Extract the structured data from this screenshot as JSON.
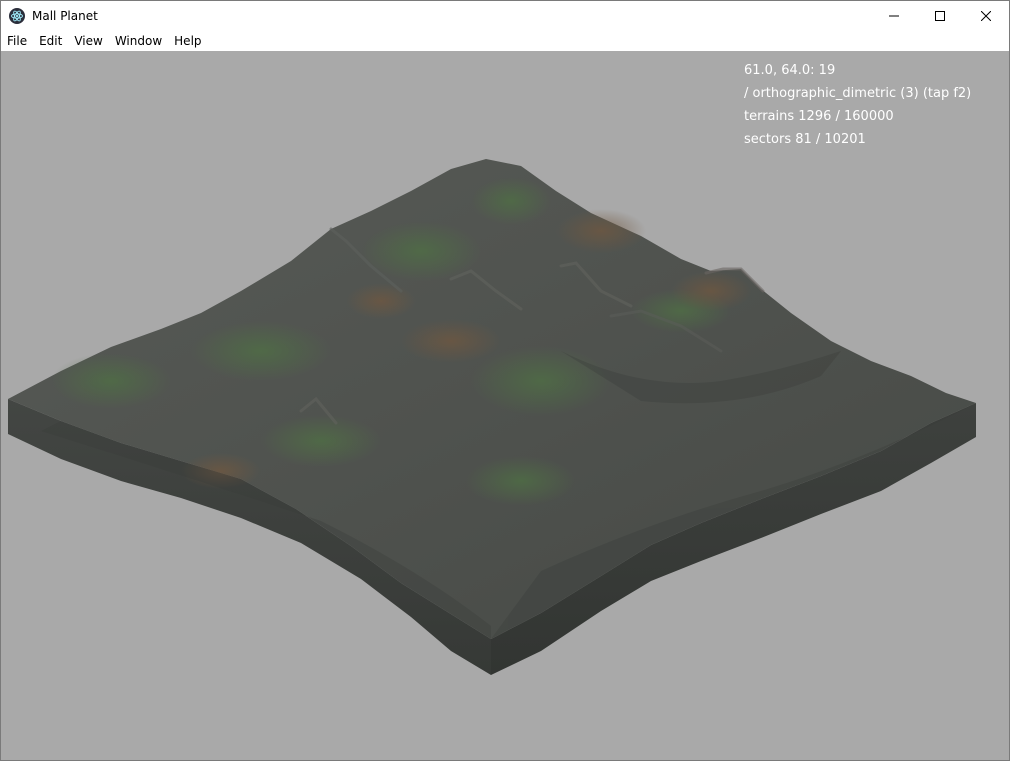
{
  "window": {
    "title": "Mall Planet",
    "app_icon": "electron-atom-icon",
    "controls": [
      "minimize-icon",
      "maximize-icon",
      "close-icon"
    ]
  },
  "menu": {
    "items": [
      {
        "label": "File"
      },
      {
        "label": "Edit"
      },
      {
        "label": "View"
      },
      {
        "label": "Window"
      },
      {
        "label": "Help"
      }
    ]
  },
  "viewport": {
    "background": "#a9a9a9",
    "hud": {
      "coords": "61.0, 64.0: 19",
      "camera": "/ orthographic_dimetric (3) (tap f2)",
      "terrains": "terrains 1296 / 160000",
      "sectors": "sectors 81 / 10201"
    },
    "terrain_colors": {
      "rock": "#4f524f",
      "side": "#3d403d",
      "grass": "#4e6a45",
      "dirt": "#6b5a48"
    }
  }
}
